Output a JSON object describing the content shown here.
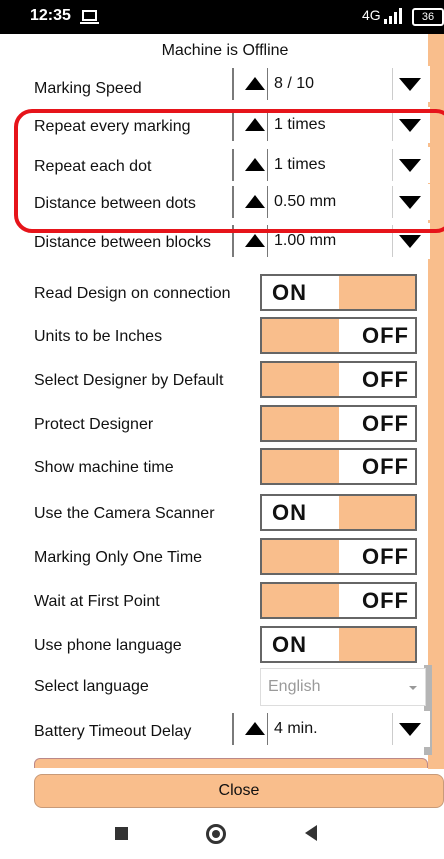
{
  "status_bar": {
    "time": "12:35",
    "network": "4G",
    "battery": "36"
  },
  "header": {
    "status_text": "Machine is Offline"
  },
  "settings": {
    "spinners": [
      {
        "label": "Marking Speed",
        "value": "8 / 10"
      },
      {
        "label": "Repeat every marking",
        "value": "1 times"
      },
      {
        "label": "Repeat each dot",
        "value": "1 times"
      },
      {
        "label": "Distance between dots",
        "value": "0.50 mm"
      },
      {
        "label": "Distance between blocks",
        "value": "1.00 mm"
      }
    ],
    "toggles": [
      {
        "label": "Read Design on connection",
        "state": "ON"
      },
      {
        "label": "Units to be Inches",
        "state": "OFF"
      },
      {
        "label": "Select Designer by Default",
        "state": "OFF"
      },
      {
        "label": "Protect Designer",
        "state": "OFF"
      },
      {
        "label": "Show machine time",
        "state": "OFF"
      },
      {
        "label": "Use the Camera Scanner",
        "state": "ON"
      },
      {
        "label": "Marking Only One Time",
        "state": "OFF"
      },
      {
        "label": "Wait at First Point",
        "state": "OFF"
      },
      {
        "label": "Use phone language",
        "state": "ON"
      }
    ],
    "language": {
      "label": "Select language",
      "value": "English"
    },
    "battery_timeout": {
      "label": "Battery Timeout Delay",
      "value": "4 min."
    }
  },
  "footer": {
    "close_label": "Close"
  },
  "colors": {
    "accent": "#f9be8c",
    "highlight": "#e6141a"
  },
  "nav": {
    "icons": [
      "recents-square-icon",
      "home-circle-icon",
      "back-triangle-icon"
    ]
  }
}
